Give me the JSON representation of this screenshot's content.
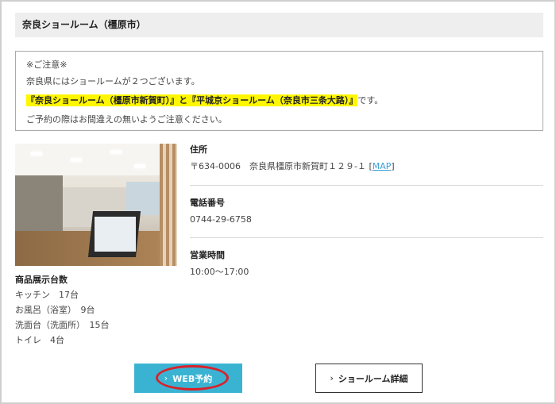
{
  "header": {
    "title": "奈良ショールーム（橿原市）"
  },
  "notice": {
    "heading": "※ご注意※",
    "line1": "奈良県にはショールームが２つございます。",
    "highlight": "『奈良ショールーム（橿原市新賀町）』と『平城京ショールーム（奈良市三条大路）』",
    "line2_suffix": "です。",
    "line3": "ご予約の際はお間違えの無いようご注意ください。"
  },
  "specs": {
    "heading": "商品展示台数",
    "items": [
      "キッチン　17台",
      "お風呂（浴室）　9台",
      "洗面台（洗面所）　15台",
      "トイレ　4台"
    ]
  },
  "info": {
    "address": {
      "label": "住所",
      "value": "〒634-0006　奈良県橿原市新賀町１２９-１",
      "bracket_open": "[",
      "map_link": "MAP",
      "bracket_close": "]"
    },
    "phone": {
      "label": "電話番号",
      "value": "0744-29-6758"
    },
    "hours": {
      "label": "営業時間",
      "value": "10:00〜17:00"
    }
  },
  "buttons": {
    "web_reserve": "WEB予約",
    "detail": "ショールーム詳細",
    "chevron": "›"
  },
  "colors": {
    "accent": "#3ab3d3",
    "highlight": "#fff700",
    "annotation_ring": "#d8222a",
    "link": "#3b9fd6"
  },
  "icons": {
    "photo": "showroom-photo"
  }
}
